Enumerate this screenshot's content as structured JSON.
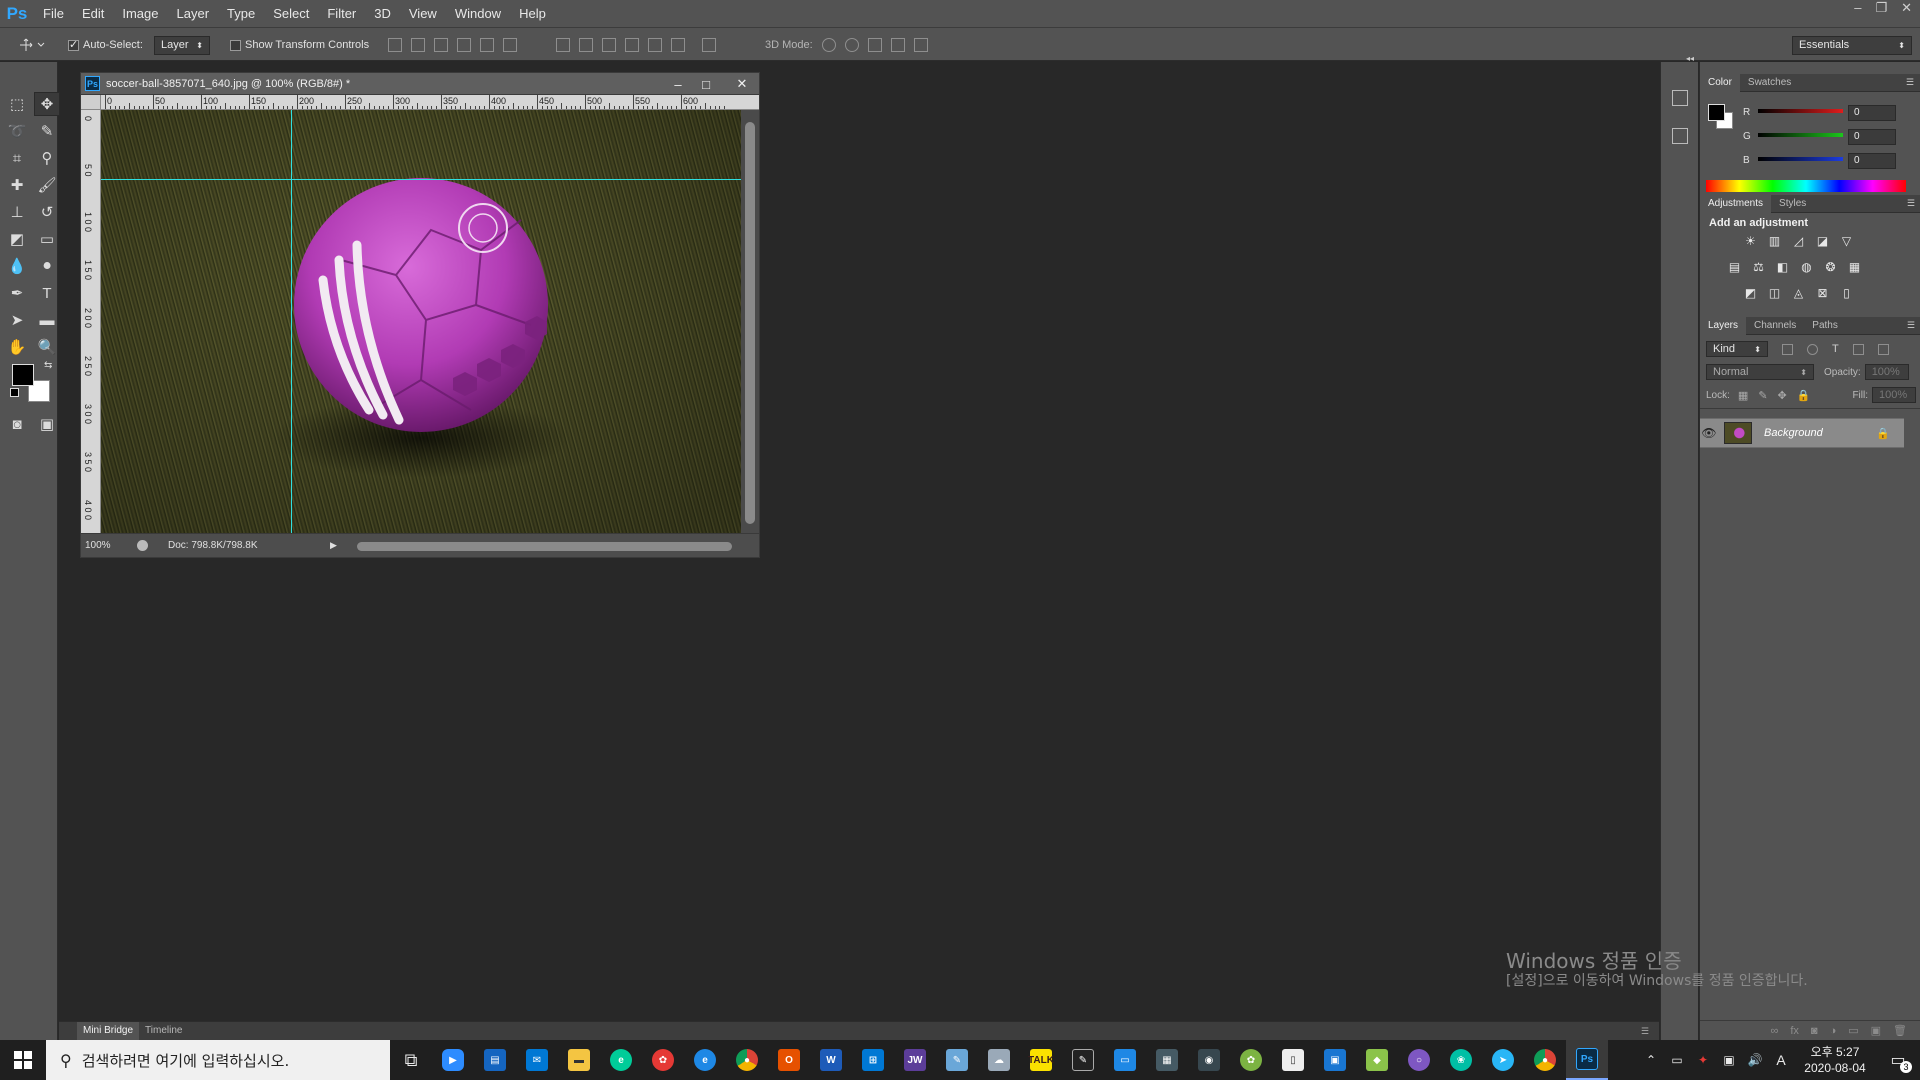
{
  "menubar": {
    "logo": "Ps",
    "items": [
      "File",
      "Edit",
      "Image",
      "Layer",
      "Type",
      "Select",
      "Filter",
      "3D",
      "View",
      "Window",
      "Help"
    ],
    "window_controls": [
      "–",
      "❐",
      "✕"
    ]
  },
  "options": {
    "auto_select_label": "Auto-Select:",
    "auto_select_value": "Layer",
    "show_transform_label": "Show Transform Controls",
    "mode_3d_label": "3D Mode:",
    "workspace": "Essentials"
  },
  "document": {
    "title": "soccer-ball-3857071_640.jpg @ 100% (RGB/8#) *",
    "zoom": "100%",
    "doc_size": "Doc: 798.8K/798.8K",
    "ruler_top_labels": [
      "0",
      "50",
      "100",
      "150",
      "200",
      "250",
      "300",
      "350",
      "400",
      "450",
      "500",
      "550",
      "600"
    ],
    "ruler_left_labels": [
      "0",
      "5 0",
      "1 0 0",
      "1 5 0",
      "2 0 0",
      "2 5 0",
      "3 0 0",
      "3 5 0",
      "4 0 0"
    ]
  },
  "color_panel": {
    "tabs": [
      "Color",
      "Swatches"
    ],
    "channels": [
      {
        "label": "R",
        "value": "0",
        "color": "#d01c1c"
      },
      {
        "label": "G",
        "value": "0",
        "color": "#1cc61c"
      },
      {
        "label": "B",
        "value": "0",
        "color": "#1c3ce0"
      }
    ]
  },
  "adjustments_panel": {
    "tabs": [
      "Adjustments",
      "Styles"
    ],
    "heading": "Add an adjustment"
  },
  "layers_panel": {
    "tabs": [
      "Layers",
      "Channels",
      "Paths"
    ],
    "kind_filter": "Kind",
    "blend_mode": "Normal",
    "opacity_label": "Opacity:",
    "opacity_value": "100%",
    "lock_label": "Lock:",
    "fill_label": "Fill:",
    "fill_value": "100%",
    "layers": [
      {
        "name": "Background",
        "visible": true,
        "locked": true
      }
    ]
  },
  "bottom_dock": {
    "tabs": [
      "Mini Bridge",
      "Timeline"
    ]
  },
  "watermark": {
    "line1": "Windows 정품 인증",
    "line2": "[설정]으로 이동하여 Windows를 정품 인증합니다."
  },
  "taskbar": {
    "search_placeholder": "검색하려면 여기에 입력하십시오.",
    "time": "오후 5:27",
    "date": "2020-08-04",
    "notification_count": "3",
    "ime": "A"
  },
  "colors": {
    "panel_bg": "#535353",
    "workspace_bg": "#282828",
    "guide": "#2fe0e0",
    "ball": "#b13bb4"
  }
}
